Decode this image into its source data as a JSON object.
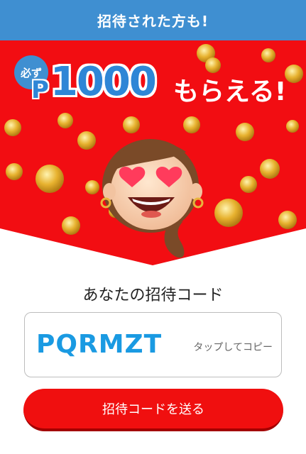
{
  "header": {
    "text": "招待された方も!"
  },
  "promo": {
    "badge": "必ず",
    "currency_mark": "P",
    "amount": "1000",
    "suffix": "もらえる!"
  },
  "invite": {
    "title": "あなたの招待コード",
    "code": "PQRMZT",
    "copy_hint": "タップしてコピー"
  },
  "send_button": {
    "label": "招待コードを送る"
  },
  "colors": {
    "header_blue": "#3f8fd1",
    "hero_red": "#f20d12",
    "code_blue": "#1a9ae2",
    "coin_gold": "#e7b22f"
  }
}
